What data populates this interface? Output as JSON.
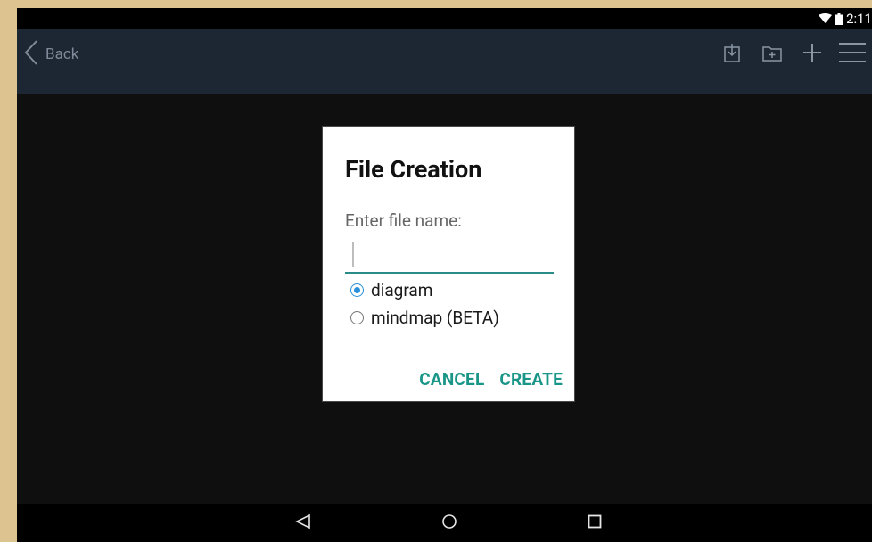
{
  "status_bar": {
    "time": "2:11"
  },
  "action_bar": {
    "back_label": "Back",
    "icons": [
      "import-icon",
      "new-folder-icon",
      "add-icon",
      "menu-icon"
    ]
  },
  "dialog": {
    "title": "File Creation",
    "prompt": "Enter file name:",
    "file_name_value": "",
    "options": [
      {
        "label": "diagram",
        "checked": true
      },
      {
        "label": "mindmap (BETA)",
        "checked": false
      }
    ],
    "cancel_label": "CANCEL",
    "create_label": "CREATE"
  },
  "navigation": [
    "back-nav-icon",
    "home-nav-icon",
    "recents-nav-icon"
  ],
  "colors": {
    "accent": "#1a9688",
    "radio": "#2b90d9",
    "action_bar": "#1d2633",
    "field_underline": "#2a8c88"
  }
}
